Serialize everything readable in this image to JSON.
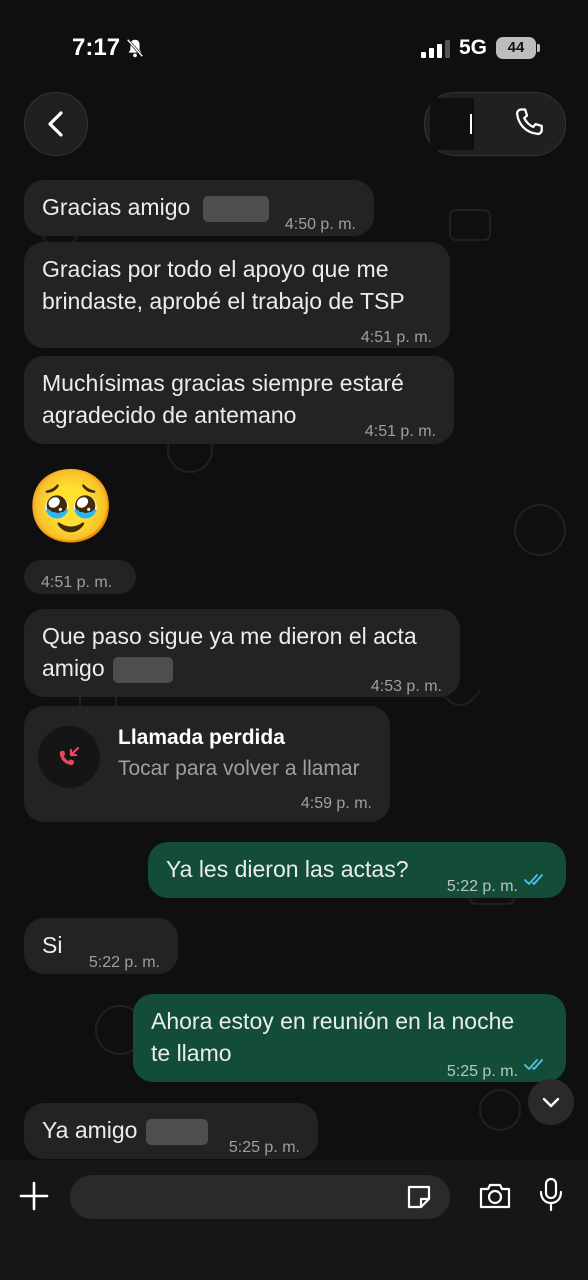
{
  "status_bar": {
    "time": "7:17",
    "network": "5G",
    "battery": "44"
  },
  "header": {
    "contact_name": ""
  },
  "messages": [
    {
      "dir": "in",
      "text": "Gracias amigo",
      "time": "4:50 p. m."
    },
    {
      "dir": "in",
      "line1": "Gracias por todo el apoyo que me",
      "line2": "brindaste, aprobé el trabajo de TSP",
      "time": "4:51 p. m."
    },
    {
      "dir": "in",
      "line1": "Muchísimas gracias siempre estaré",
      "line2": "agradecido de antemano",
      "time": "4:51 p. m."
    },
    {
      "dir": "in",
      "emoji": "🥹",
      "time": "4:51 p. m."
    },
    {
      "dir": "in",
      "line1": "Que paso sigue ya me dieron el acta",
      "line2": "amigo",
      "time": "4:53 p. m."
    },
    {
      "dir": "in",
      "call_title": "Llamada perdida",
      "call_sub": "Tocar para volver a llamar",
      "time": "4:59 p. m."
    },
    {
      "dir": "out",
      "text": "Ya les dieron las actas?",
      "time": "5:22 p. m."
    },
    {
      "dir": "in",
      "text": "Si",
      "time": "5:22 p. m."
    },
    {
      "dir": "out",
      "line1": "Ahora estoy en reunión en la noche",
      "line2": "te llamo",
      "time": "5:25 p. m."
    },
    {
      "dir": "in",
      "text": "Ya amigo",
      "time": "5:25 p. m."
    }
  ],
  "composer": {
    "placeholder": ""
  },
  "icons": {
    "back": "chevron-left-icon",
    "phone": "phone-icon",
    "plus": "plus-icon",
    "sticker": "sticker-icon",
    "camera": "camera-icon",
    "mic": "mic-icon",
    "scroll_down": "chevron-down-icon",
    "missed_call": "missed-call-icon",
    "read_ticks": "double-check-icon",
    "mute": "bell-slash-icon"
  },
  "colors": {
    "incoming_bubble": "#232323",
    "outgoing_bubble": "#144d37",
    "missed_call": "#e8475f",
    "read_tick": "#53bdeb"
  }
}
